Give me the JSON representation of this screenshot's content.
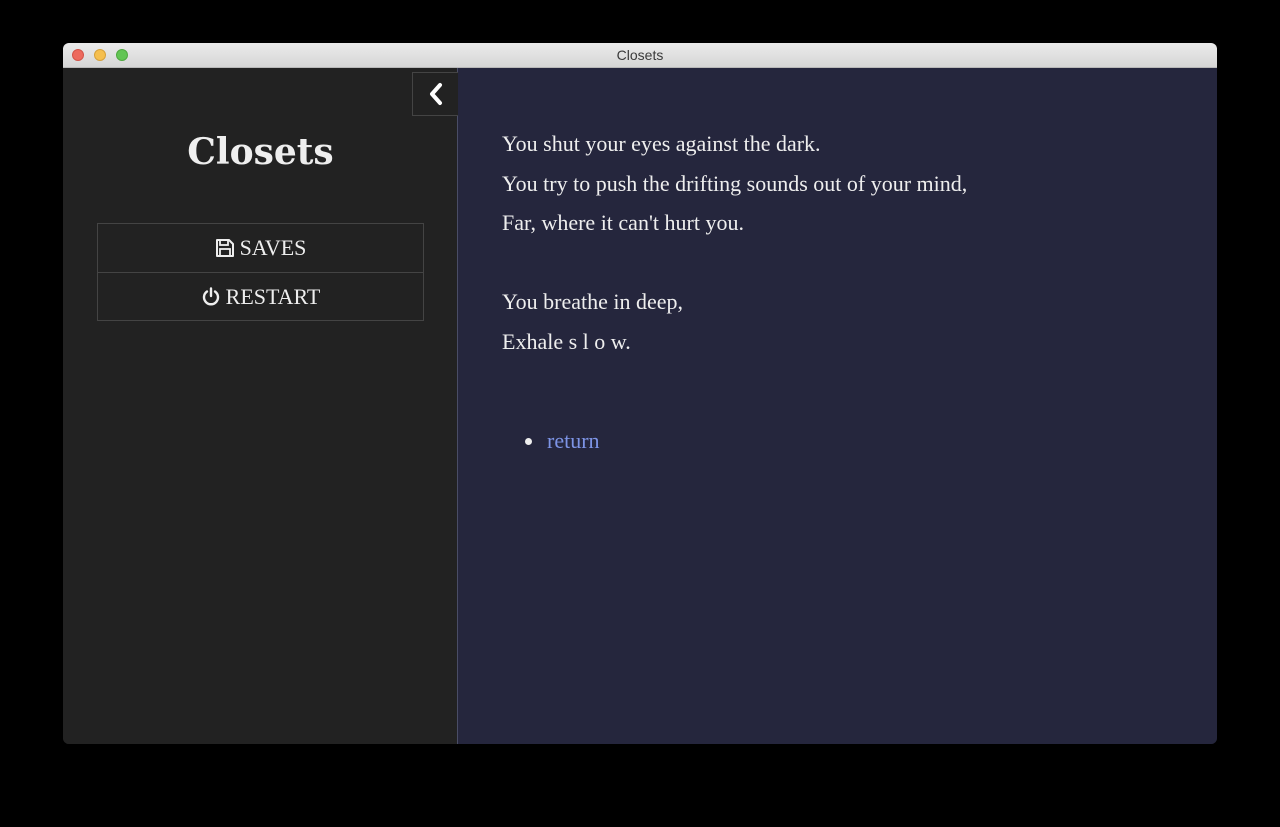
{
  "window": {
    "title": "Closets"
  },
  "sidebar": {
    "story_title": "Closets",
    "menu": [
      {
        "icon": "save-icon",
        "label": "SAVES"
      },
      {
        "icon": "power-icon",
        "label": "RESTART"
      }
    ],
    "collapse_icon": "chevron-left-icon"
  },
  "passage": {
    "lines": [
      "You shut your eyes against the dark.",
      "You try to push the drifting sounds out of your mind,",
      "Far, where it can't hurt you.",
      "",
      "You breathe in deep,",
      "Exhale s l o w."
    ],
    "choices": [
      {
        "label": "return"
      }
    ]
  },
  "colors": {
    "sidebar_bg": "#222222",
    "passage_bg": "#25263d",
    "text": "#eeeeee",
    "link": "#7d94e6"
  }
}
